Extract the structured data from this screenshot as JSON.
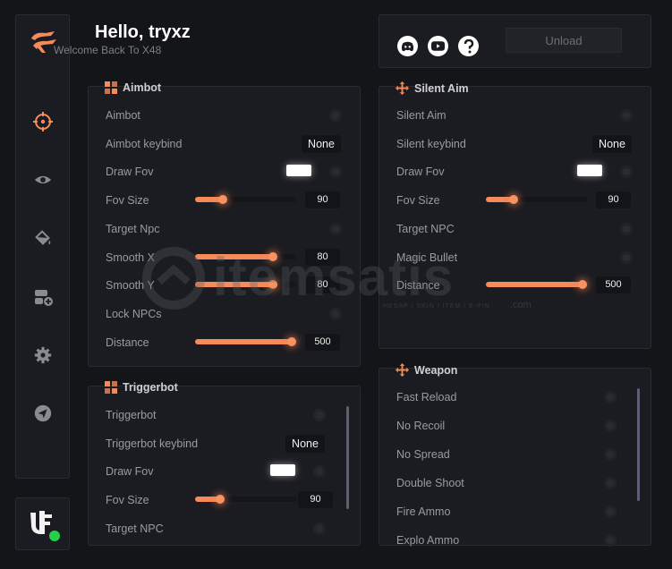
{
  "header": {
    "greeting": "Hello, tryxz",
    "welcome": "Welcome Back To X48"
  },
  "sidebar": {
    "items": [
      {
        "icon": "crosshair-icon",
        "active": true
      },
      {
        "icon": "eye-icon",
        "active": false
      },
      {
        "icon": "paint-bucket-icon",
        "active": false
      },
      {
        "icon": "add-item-icon",
        "active": false
      },
      {
        "icon": "gear-icon",
        "active": false
      },
      {
        "icon": "send-icon",
        "active": false
      }
    ]
  },
  "user": {
    "status": "online",
    "status_color": "#22d04a"
  },
  "top": {
    "icons": [
      "discord-icon",
      "youtube-icon",
      "help-icon"
    ],
    "unload_label": "Unload"
  },
  "aimbot": {
    "title": "Aimbot",
    "rows": [
      {
        "label": "Aimbot",
        "kind": "toggle"
      },
      {
        "label": "Aimbot keybind",
        "kind": "keybind",
        "value": "None"
      },
      {
        "label": "Draw Fov",
        "kind": "color"
      },
      {
        "label": "Fov Size",
        "kind": "slider",
        "value": "90",
        "fill": 0.27
      },
      {
        "label": "Target Npc",
        "kind": "toggle"
      },
      {
        "label": "Smooth X",
        "kind": "slider",
        "value": "80",
        "fill": 0.77
      },
      {
        "label": "Smooth Y",
        "kind": "slider",
        "value": "80",
        "fill": 0.77
      },
      {
        "label": "Lock NPCs",
        "kind": "toggle"
      },
      {
        "label": "Distance",
        "kind": "slider",
        "value": "500",
        "fill": 0.96
      }
    ]
  },
  "silent_aim": {
    "title": "Silent Aim",
    "rows": [
      {
        "label": "Silent Aim",
        "kind": "toggle"
      },
      {
        "label": "Silent keybind",
        "kind": "keybind",
        "value": "None"
      },
      {
        "label": "Draw Fov",
        "kind": "color"
      },
      {
        "label": "Fov Size",
        "kind": "slider",
        "value": "90",
        "fill": 0.27
      },
      {
        "label": "Target NPC",
        "kind": "toggle"
      },
      {
        "label": "Magic Bullet",
        "kind": "toggle"
      },
      {
        "label": "Distance",
        "kind": "slider",
        "value": "500",
        "fill": 0.96
      }
    ]
  },
  "triggerbot": {
    "title": "Triggerbot",
    "rows": [
      {
        "label": "Triggerbot",
        "kind": "toggle"
      },
      {
        "label": "Triggerbot keybind",
        "kind": "keybind",
        "value": "None"
      },
      {
        "label": "Draw Fov",
        "kind": "color"
      },
      {
        "label": "Fov Size",
        "kind": "slider",
        "value": "90",
        "fill": 0.25
      },
      {
        "label": "Target NPC",
        "kind": "toggle"
      }
    ]
  },
  "weapon": {
    "title": "Weapon",
    "rows": [
      {
        "label": "Fast Reload",
        "kind": "toggle"
      },
      {
        "label": "No Recoil",
        "kind": "toggle"
      },
      {
        "label": "No Spread",
        "kind": "toggle"
      },
      {
        "label": "Double Shoot",
        "kind": "toggle"
      },
      {
        "label": "Fire Ammo",
        "kind": "toggle"
      },
      {
        "label": "Explo Ammo",
        "kind": "toggle"
      }
    ]
  },
  "watermark": {
    "brand": "itemsatis",
    "tagline": "HESAP / SKIN / ITEM / E-PIN",
    "domain": ".com"
  },
  "colors": {
    "accent": "#f58a5a",
    "panel": "#1b1c21",
    "background": "#141519"
  }
}
